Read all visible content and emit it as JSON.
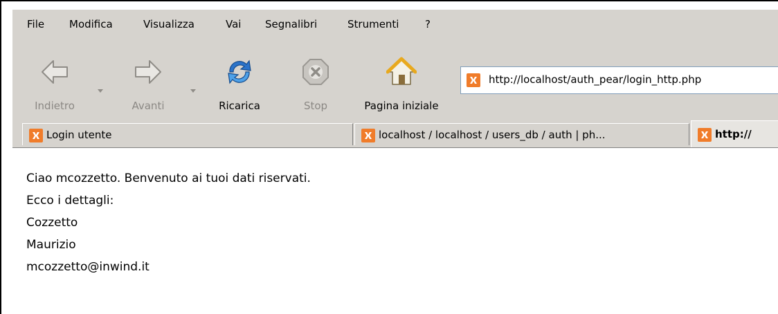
{
  "menu": [
    {
      "label": "File"
    },
    {
      "label": "Modifica"
    },
    {
      "label": "Visualizza"
    },
    {
      "label": "Vai"
    },
    {
      "label": "Segnalibri"
    },
    {
      "label": "Strumenti"
    },
    {
      "label": "?"
    }
  ],
  "toolbar": {
    "back_label": "Indietro",
    "forward_label": "Avanti",
    "reload_label": "Ricarica",
    "stop_label": "Stop",
    "home_label": "Pagina iniziale"
  },
  "address": {
    "url": "http://localhost/auth_pear/login_http.php"
  },
  "tabs": [
    {
      "label": "Login utente"
    },
    {
      "label": "localhost / localhost / users_db  / auth | ph..."
    },
    {
      "label": "http://"
    }
  ],
  "content": {
    "greeting": "Ciao mcozzetto. Benvenuto ai tuoi dati riservati.",
    "details_heading": "Ecco i dettagli:",
    "surname": "Cozzetto",
    "name": "Maurizio",
    "email": "mcozzetto@inwind.it"
  },
  "colors": {
    "chrome": "#d6d3ce",
    "favicon": "#f07c2a",
    "reload_blue": "#2b73c9"
  }
}
